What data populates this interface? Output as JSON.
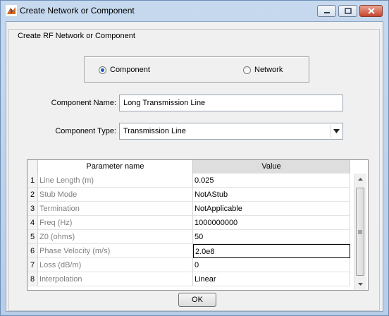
{
  "window": {
    "title": "Create Network or Component",
    "controls": {
      "minimize_icon": "minimize-icon",
      "maximize_icon": "maximize-icon",
      "close_icon": "close-icon"
    }
  },
  "group": {
    "label": "Create RF Network or Component"
  },
  "mode": {
    "options": [
      {
        "label": "Component",
        "selected": true
      },
      {
        "label": "Network",
        "selected": false
      }
    ]
  },
  "form": {
    "name_label": "Component Name:",
    "name_value": "Long Transmission Line",
    "type_label": "Component Type:",
    "type_value": "Transmission Line"
  },
  "table": {
    "headers": {
      "name": "Parameter name",
      "value": "Value"
    },
    "rows": [
      {
        "index": "1",
        "name": "Line Length (m)",
        "value": "0.025"
      },
      {
        "index": "2",
        "name": "Stub Mode",
        "value": "NotAStub"
      },
      {
        "index": "3",
        "name": "Termination",
        "value": "NotApplicable"
      },
      {
        "index": "4",
        "name": "Freq (Hz)",
        "value": "1000000000"
      },
      {
        "index": "5",
        "name": "Z0 (ohms)",
        "value": "50"
      },
      {
        "index": "6",
        "name": "Phase Velocity (m/s)",
        "value": "2.0e8"
      },
      {
        "index": "7",
        "name": "Loss (dB/m)",
        "value": "0"
      },
      {
        "index": "8",
        "name": "Interpolation",
        "value": "Linear"
      }
    ],
    "selected_row": 6
  },
  "ok_button": {
    "label": "OK"
  },
  "colors": {
    "title_bar": "#c6d9ee",
    "close_button": "#c7442c",
    "selected_radio": "#1a5fb4",
    "value_header": "#dedede"
  }
}
